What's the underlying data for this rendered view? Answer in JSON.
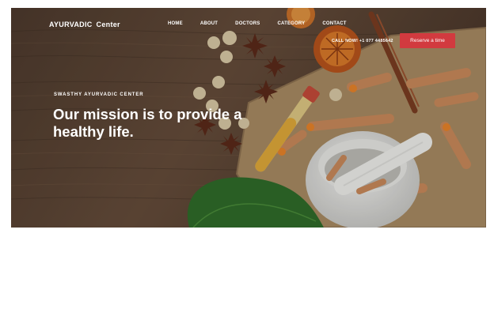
{
  "brand": {
    "name": "AYURVADIC",
    "suffix": "Center"
  },
  "nav": {
    "items": [
      "HOME",
      "ABOUT",
      "DOCTORS",
      "CATEGORY",
      "CONTACT"
    ]
  },
  "header": {
    "call": "CALL NOW!  +1 077 4485642",
    "cta": "Reserve a time"
  },
  "hero": {
    "kicker": "SWASTHY AYURVADIC CENTER",
    "headline": "Our mission is to provide a healthy life."
  },
  "colors": {
    "accent": "#d23a3f",
    "wood": "#5a4536"
  }
}
